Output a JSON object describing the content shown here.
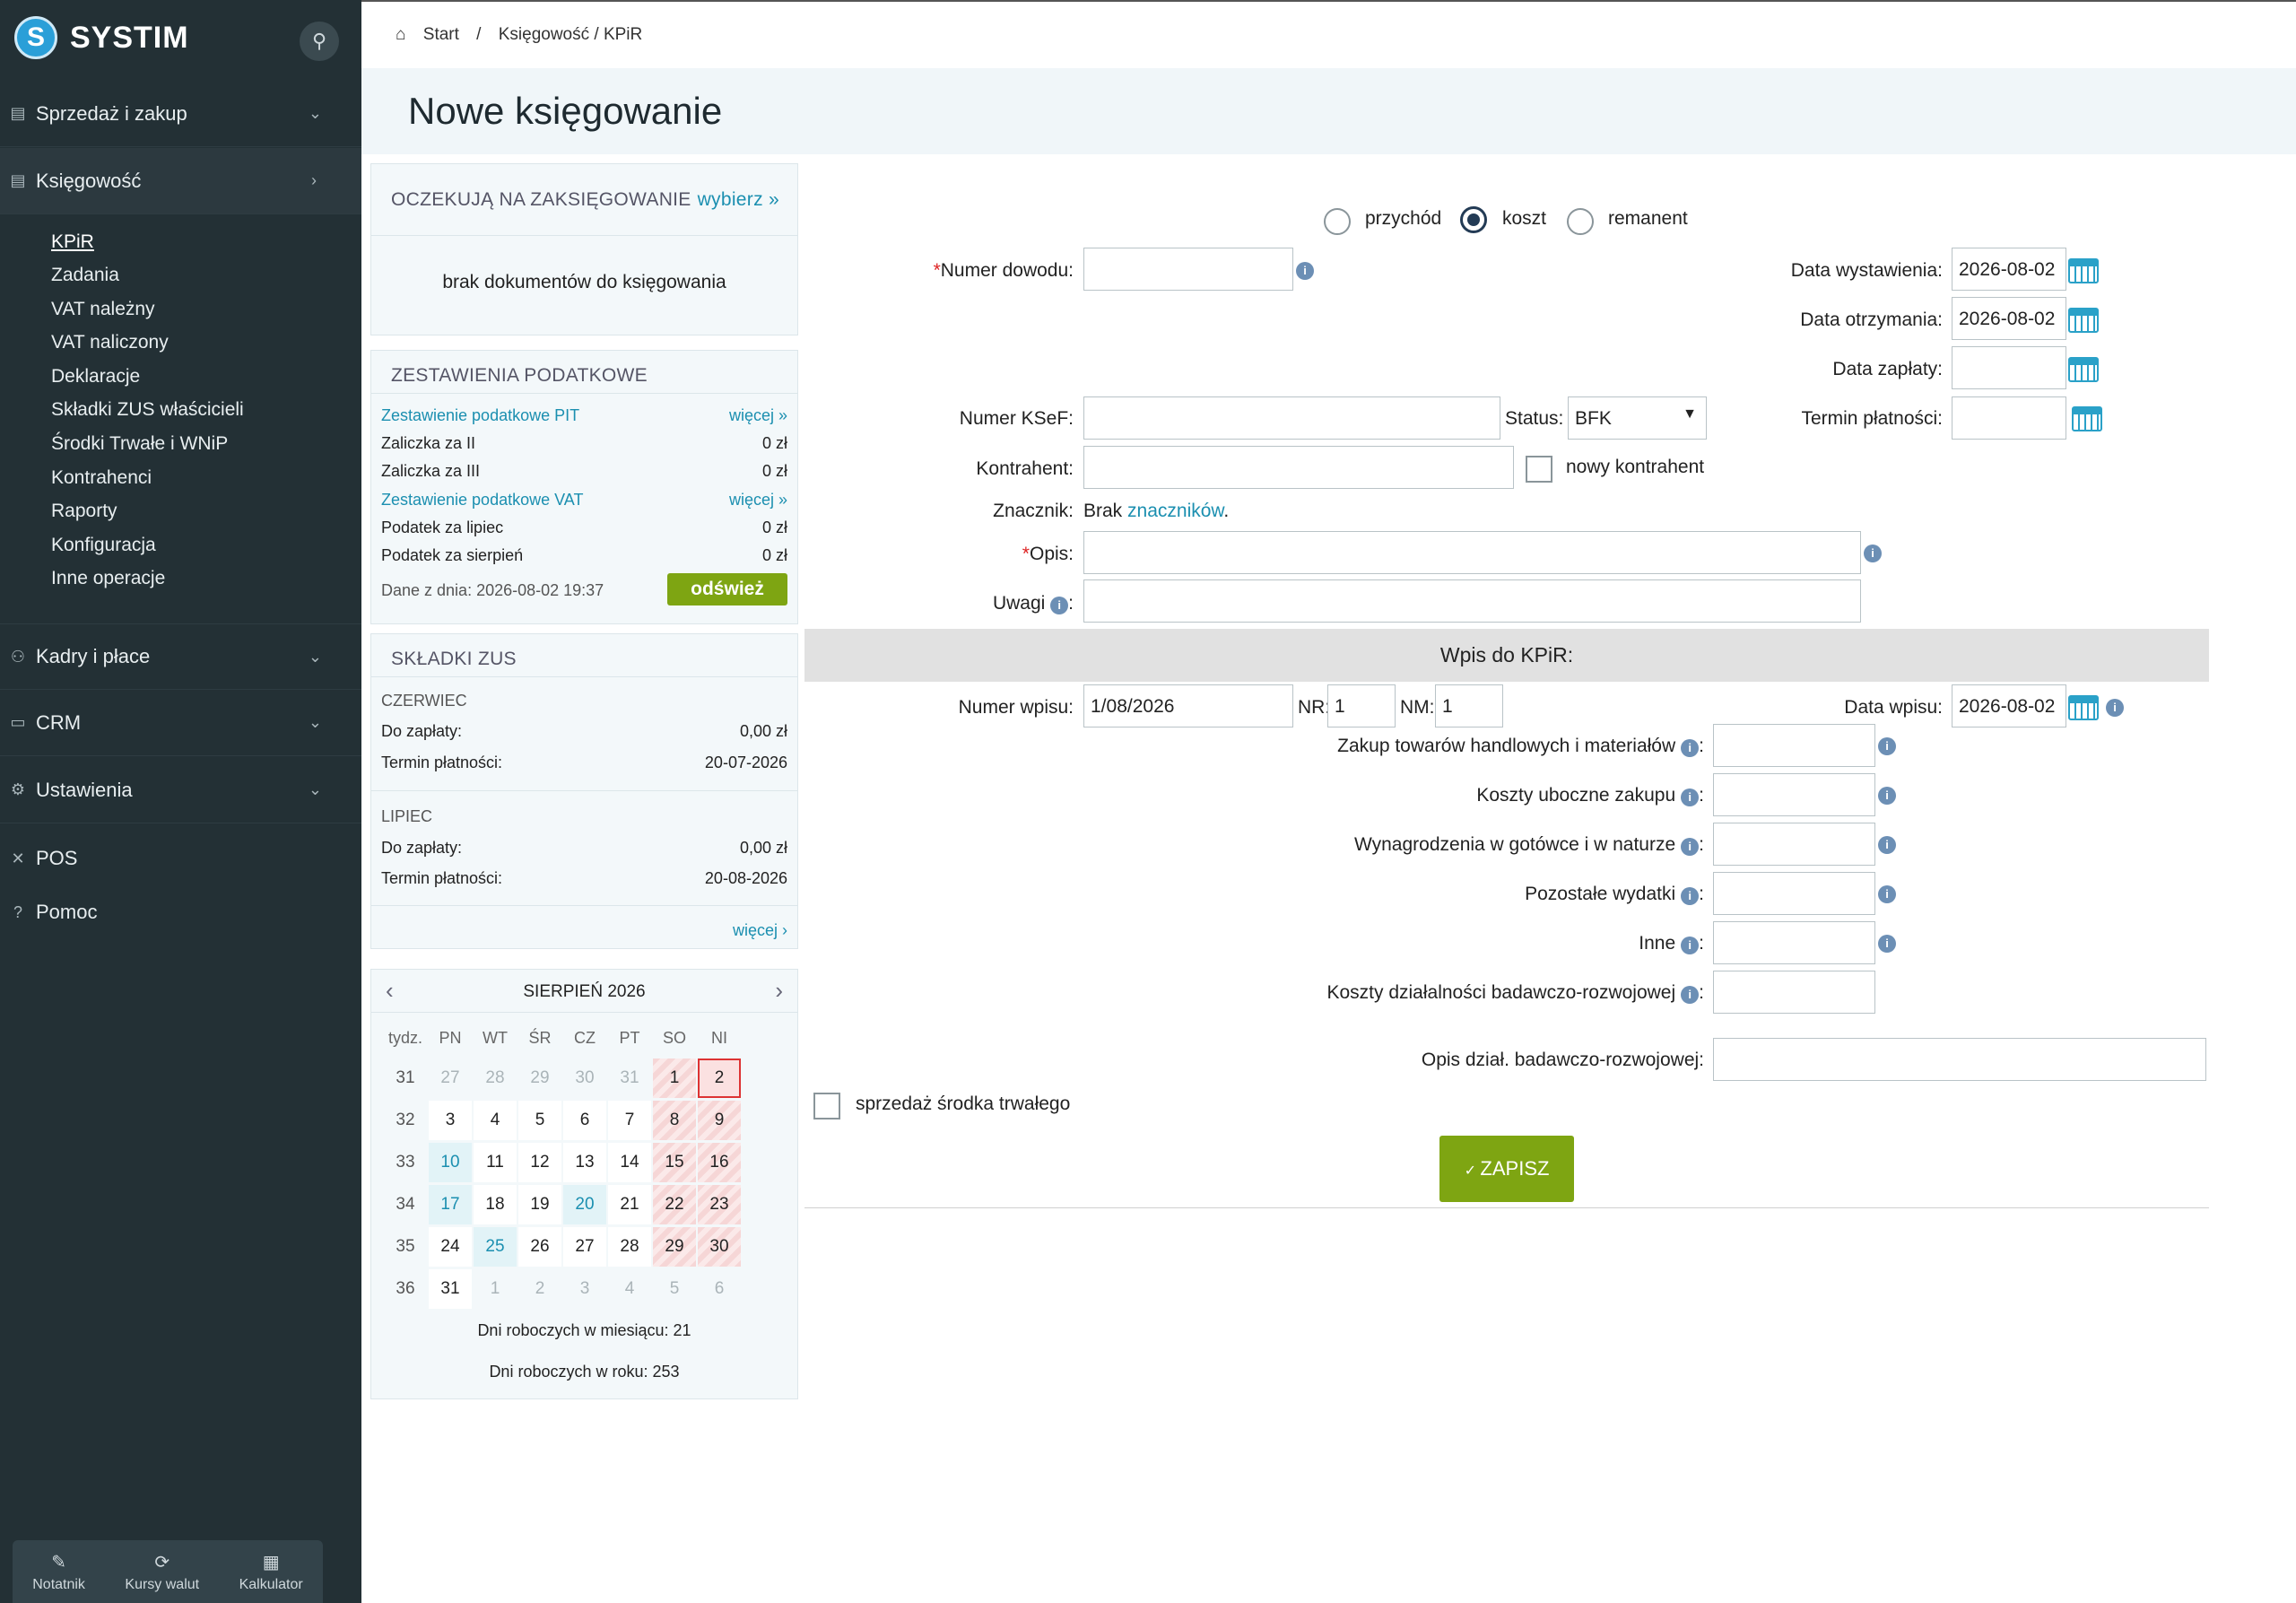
{
  "brand": {
    "name": "SYSTIM",
    "logo_letter": "S"
  },
  "sidebar": {
    "sections": [
      {
        "label": "Sprzedaż i zakup",
        "icon": "document-icon"
      },
      {
        "label": "Księgowość",
        "icon": "ledger-icon"
      },
      {
        "label": "Kadry i płace",
        "icon": "people-icon"
      },
      {
        "label": "CRM",
        "icon": "crm-icon"
      },
      {
        "label": "Ustawienia",
        "icon": "gear-icon"
      },
      {
        "label": "POS",
        "icon": "pos-icon"
      },
      {
        "label": "Pomoc",
        "icon": "help-icon"
      }
    ],
    "submenu": [
      "KPiR",
      "Zadania",
      "VAT należny",
      "VAT naliczony",
      "Deklaracje",
      "Składki ZUS właścicieli",
      "Środki Trwałe i WNiP",
      "Kontrahenci",
      "Raporty",
      "Konfiguracja",
      "Inne operacje"
    ],
    "tools": [
      "Notatnik",
      "Kursy walut",
      "Kalkulator"
    ]
  },
  "breadcrumb": {
    "start": "Start",
    "sep": "/",
    "current": "Księgowość / KPiR"
  },
  "page_title": "Nowe księgowanie",
  "pending": {
    "title": "OCZEKUJĄ NA ZAKSIĘGOWANIE",
    "link": "wybierz »",
    "empty": "brak dokumentów do księgowania"
  },
  "tax": {
    "title": "ZESTAWIENIA PODATKOWE",
    "pit_link": "Zestawienie podatkowe PIT",
    "more": "więcej »",
    "rows1": [
      {
        "label": "Zaliczka za II",
        "value": "0 zł"
      },
      {
        "label": "Zaliczka za III",
        "value": "0 zł"
      }
    ],
    "vat_link": "Zestawienie podatkowe VAT",
    "rows2": [
      {
        "label": "Podatek za lipiec",
        "value": "0 zł"
      },
      {
        "label": "Podatek za sierpień",
        "value": "0 zł"
      }
    ],
    "data_from": "Dane z dnia: 2026-08-02 19:37",
    "refresh": "odśwież"
  },
  "zus": {
    "title": "SKŁADKI ZUS",
    "months": [
      {
        "name": "CZERWIEC",
        "to_pay_label": "Do zapłaty:",
        "to_pay": "0,00 zł",
        "due_label": "Termin płatności:",
        "due": "20-07-2026"
      },
      {
        "name": "LIPIEC",
        "to_pay_label": "Do zapłaty:",
        "to_pay": "0,00 zł",
        "due_label": "Termin płatności:",
        "due": "20-08-2026"
      }
    ],
    "more": "więcej"
  },
  "calendar": {
    "title": "SIERPIEŃ 2026",
    "headers": [
      "tydz.",
      "PN",
      "WT",
      "ŚR",
      "CZ",
      "PT",
      "SO",
      "NI"
    ],
    "weeks": [
      {
        "w": "31",
        "days": [
          "27",
          "28",
          "29",
          "30",
          "31",
          "1",
          "2"
        ]
      },
      {
        "w": "32",
        "days": [
          "3",
          "4",
          "5",
          "6",
          "7",
          "8",
          "9"
        ]
      },
      {
        "w": "33",
        "days": [
          "10",
          "11",
          "12",
          "13",
          "14",
          "15",
          "16"
        ]
      },
      {
        "w": "34",
        "days": [
          "17",
          "18",
          "19",
          "20",
          "21",
          "22",
          "23"
        ]
      },
      {
        "w": "35",
        "days": [
          "24",
          "25",
          "26",
          "27",
          "28",
          "29",
          "30"
        ]
      },
      {
        "w": "36",
        "days": [
          "31",
          "1",
          "2",
          "3",
          "4",
          "5",
          "6"
        ]
      }
    ],
    "work_month": "Dni roboczych w miesiącu: 21",
    "work_year": "Dni roboczych w roku: 253"
  },
  "form": {
    "types": [
      "przychód",
      "koszt",
      "remanent"
    ],
    "selected_type": "koszt",
    "numer_dowodu": {
      "label": "Numer dowodu:",
      "value": ""
    },
    "data_wystawienia": {
      "label": "Data wystawienia:",
      "value": "2026-08-02"
    },
    "data_otrzymania": {
      "label": "Data otrzymania:",
      "value": "2026-08-02"
    },
    "data_zaplaty": {
      "label": "Data zapłaty:",
      "value": ""
    },
    "numer_ksef": {
      "label": "Numer KSeF:",
      "value": ""
    },
    "status": {
      "label": "Status:",
      "value": "BFK"
    },
    "termin_platnosci": {
      "label": "Termin płatności:",
      "value": ""
    },
    "kontrahent": {
      "label": "Kontrahent:",
      "value": "",
      "new_label": "nowy kontrahent"
    },
    "znacznik": {
      "label": "Znacznik:",
      "prefix": "Brak",
      "link": "znaczników",
      "suffix": "."
    },
    "opis": {
      "label": "Opis:",
      "value": ""
    },
    "uwagi": {
      "label": "Uwagi",
      "colon": ":",
      "value": ""
    },
    "kpir_header": "Wpis do KPiR:",
    "numer_wpisu": {
      "label": "Numer wpisu:",
      "value": "1/08/2026",
      "nr_label": "NR:",
      "nr": "1",
      "nm_label": "NM:",
      "nm": "1"
    },
    "data_wpisu": {
      "label": "Data wpisu:",
      "value": "2026-08-02"
    },
    "cost_rows": [
      "Zakup towarów handlowych i materiałów",
      "Koszty uboczne zakupu",
      "Wynagrodzenia w gotówce i w naturze",
      "Pozostałe wydatki",
      "Inne",
      "Koszty działalności badawczo-rozwojowej"
    ],
    "opis_br": {
      "label": "Opis dział. badawczo-rozwojowej:",
      "value": ""
    },
    "sprzedaz": "sprzedaż środka trwałego",
    "save": "ZAPISZ"
  },
  "colors": {
    "sidebar": "#233035",
    "accent": "#1b8fb0",
    "save": "#7ea512"
  }
}
